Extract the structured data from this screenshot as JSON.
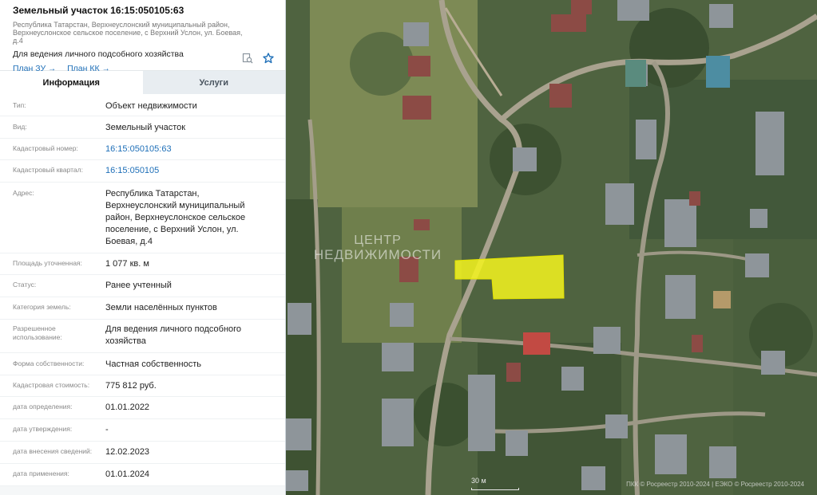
{
  "header": {
    "title": "Земельный участок 16:15:050105:63",
    "sub_address": "Республика Татарстан, Верхнеуслонский муниципальный район, Верхнеуслонское сельское поселение, с Верхний Услон, ул. Боевая, д.4",
    "purpose": "Для ведения личного подсобного хозяйства",
    "plan_zu": "План ЗУ",
    "plan_kk": "План КК",
    "arrow": "→"
  },
  "tabs": [
    {
      "label": "Информация",
      "active": true
    },
    {
      "label": "Услуги",
      "active": false
    }
  ],
  "rows": [
    {
      "label": "Тип:",
      "value": "Объект недвижимости"
    },
    {
      "label": "Вид:",
      "value": "Земельный участок"
    },
    {
      "label": "Кадастровый номер:",
      "value": "16:15:050105:63"
    },
    {
      "label": "Кадастровый квартал:",
      "value": "16:15:050105"
    },
    {
      "label": "Адрес:",
      "value": "Республика Татарстан, Верхнеуслонский муниципальный район, Верхнеуслонское сельское поселение, с Верхний Услон, ул. Боевая, д.4"
    },
    {
      "label": "Площадь уточненная:",
      "value": "1 077 кв. м"
    },
    {
      "label": "Статус:",
      "value": "Ранее учтенный"
    },
    {
      "label": "Категория земель:",
      "value": "Земли населённых пунктов"
    },
    {
      "label": "Разрешенное использование:",
      "value": "Для ведения личного подсобного хозяйства"
    },
    {
      "label": "Форма собственности:",
      "value": "Частная собственность"
    },
    {
      "label": "Кадастровая стоимость:",
      "value": "775 812 руб."
    },
    {
      "label": "дата определения:",
      "value": "01.01.2022"
    },
    {
      "label": "дата утверждения:",
      "value": "-"
    },
    {
      "label": "дата внесения сведений:",
      "value": "12.02.2023"
    },
    {
      "label": "дата применения:",
      "value": "01.01.2024"
    }
  ],
  "map": {
    "watermark_line1": "ЦЕНТР",
    "watermark_line2": "НЕДВИЖИМОСТИ",
    "scale_label": "30 м",
    "copyright": "ПКК © Росреестр 2010-2024 | ЕЭКО © Росреестр 2010-2024",
    "parcel_color": "#f5f51e"
  },
  "icons": {
    "search_doc": "search-document-icon",
    "favorite": "star-icon"
  },
  "colors": {
    "link": "#1e6fb8",
    "tab_inactive_bg": "#e8edf1"
  }
}
